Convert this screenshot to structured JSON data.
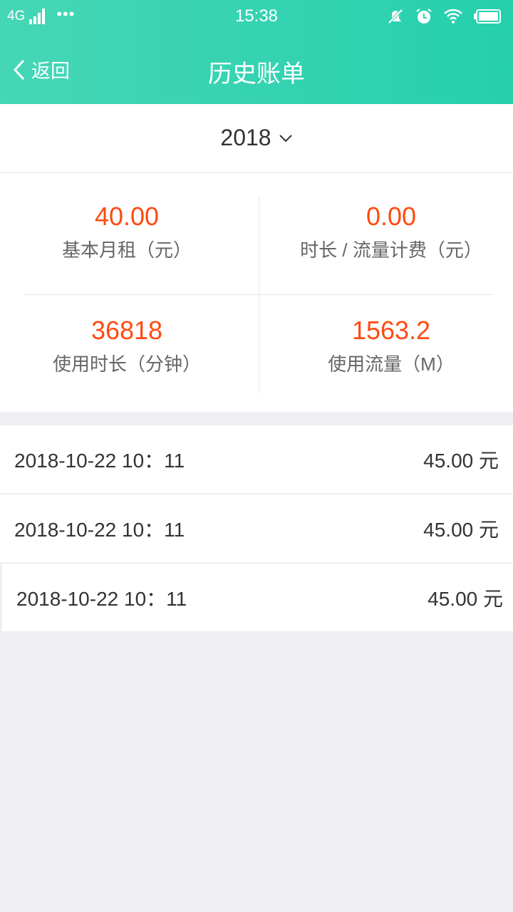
{
  "status": {
    "network": "4G",
    "time": "15:38"
  },
  "nav": {
    "back_label": "返回",
    "title": "历史账单"
  },
  "year": "2018",
  "stats": [
    {
      "value": "40.00",
      "label": "基本月租（元）"
    },
    {
      "value": "0.00",
      "label": "时长 / 流量计费（元）"
    },
    {
      "value": "36818",
      "label": "使用时长（分钟）"
    },
    {
      "value": "1563.2",
      "label": "使用流量（M）"
    }
  ],
  "bills": [
    {
      "datetime": "2018-10-22  10：11",
      "amount": "45.00 元"
    },
    {
      "datetime": "2018-10-22  10：11",
      "amount": "45.00 元"
    },
    {
      "datetime": "2018-10-22  10：11",
      "amount": "45.00 元"
    }
  ],
  "colors": {
    "header_start": "#45d7b5",
    "header_end": "#26cfae",
    "value": "#ff4a12",
    "background": "#efeff4"
  }
}
